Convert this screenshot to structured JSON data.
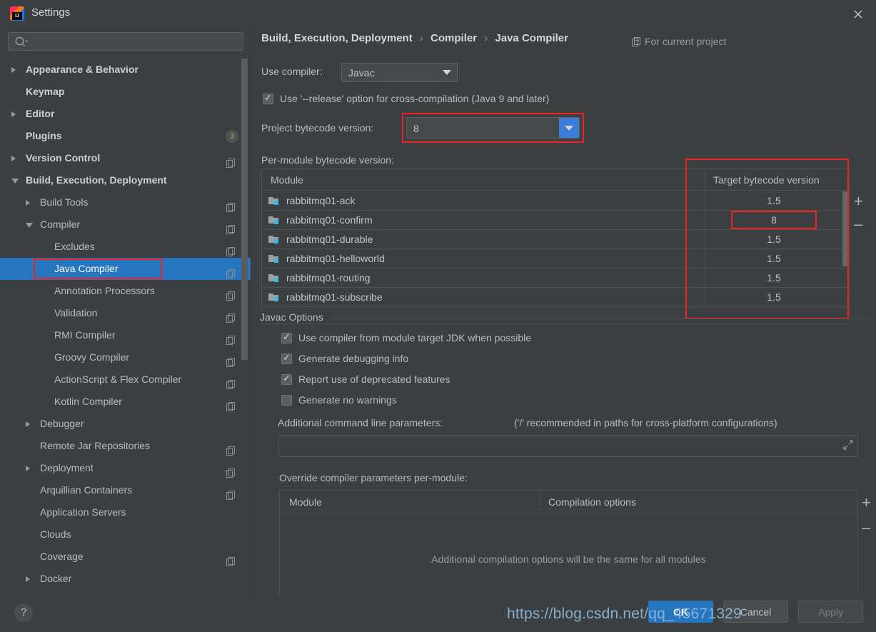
{
  "window": {
    "title": "Settings",
    "app_icon": "intellij-idea-icon",
    "close_icon": "close-icon"
  },
  "search": {
    "placeholder": "",
    "value": "",
    "icon": "search-icon"
  },
  "sidebar": {
    "scrollbar": "vertical-scrollbar",
    "items": [
      {
        "label": "Appearance & Behavior",
        "indent": 36,
        "arrow": "right",
        "bold": true,
        "copy": false,
        "badge": null,
        "selected": false
      },
      {
        "label": "Keymap",
        "indent": 36,
        "arrow": "none",
        "bold": true,
        "copy": false,
        "badge": null,
        "selected": false
      },
      {
        "label": "Editor",
        "indent": 36,
        "arrow": "right",
        "bold": true,
        "copy": false,
        "badge": null,
        "selected": false
      },
      {
        "label": "Plugins",
        "indent": 36,
        "arrow": "none",
        "bold": true,
        "copy": false,
        "badge": "3",
        "selected": false
      },
      {
        "label": "Version Control",
        "indent": 36,
        "arrow": "right",
        "bold": true,
        "copy": true,
        "badge": null,
        "selected": false
      },
      {
        "label": "Build, Execution, Deployment",
        "indent": 36,
        "arrow": "down",
        "bold": true,
        "copy": false,
        "badge": null,
        "selected": false
      },
      {
        "label": "Build Tools",
        "indent": 56,
        "arrow": "right",
        "bold": false,
        "copy": true,
        "badge": null,
        "selected": false
      },
      {
        "label": "Compiler",
        "indent": 56,
        "arrow": "down",
        "bold": false,
        "copy": true,
        "badge": null,
        "selected": false
      },
      {
        "label": "Excludes",
        "indent": 76,
        "arrow": "none",
        "bold": false,
        "copy": true,
        "badge": null,
        "selected": false
      },
      {
        "label": "Java Compiler",
        "indent": 76,
        "arrow": "none",
        "bold": false,
        "copy": true,
        "badge": null,
        "selected": true
      },
      {
        "label": "Annotation Processors",
        "indent": 76,
        "arrow": "none",
        "bold": false,
        "copy": true,
        "badge": null,
        "selected": false
      },
      {
        "label": "Validation",
        "indent": 76,
        "arrow": "none",
        "bold": false,
        "copy": true,
        "badge": null,
        "selected": false
      },
      {
        "label": "RMI Compiler",
        "indent": 76,
        "arrow": "none",
        "bold": false,
        "copy": true,
        "badge": null,
        "selected": false
      },
      {
        "label": "Groovy Compiler",
        "indent": 76,
        "arrow": "none",
        "bold": false,
        "copy": true,
        "badge": null,
        "selected": false
      },
      {
        "label": "ActionScript & Flex Compiler",
        "indent": 76,
        "arrow": "none",
        "bold": false,
        "copy": true,
        "badge": null,
        "selected": false
      },
      {
        "label": "Kotlin Compiler",
        "indent": 76,
        "arrow": "none",
        "bold": false,
        "copy": true,
        "badge": null,
        "selected": false
      },
      {
        "label": "Debugger",
        "indent": 56,
        "arrow": "right",
        "bold": false,
        "copy": false,
        "badge": null,
        "selected": false
      },
      {
        "label": "Remote Jar Repositories",
        "indent": 56,
        "arrow": "none",
        "bold": false,
        "copy": true,
        "badge": null,
        "selected": false
      },
      {
        "label": "Deployment",
        "indent": 56,
        "arrow": "right",
        "bold": false,
        "copy": true,
        "badge": null,
        "selected": false
      },
      {
        "label": "Arquillian Containers",
        "indent": 56,
        "arrow": "none",
        "bold": false,
        "copy": true,
        "badge": null,
        "selected": false
      },
      {
        "label": "Application Servers",
        "indent": 56,
        "arrow": "none",
        "bold": false,
        "copy": false,
        "badge": null,
        "selected": false
      },
      {
        "label": "Clouds",
        "indent": 56,
        "arrow": "none",
        "bold": false,
        "copy": false,
        "badge": null,
        "selected": false
      },
      {
        "label": "Coverage",
        "indent": 56,
        "arrow": "none",
        "bold": false,
        "copy": true,
        "badge": null,
        "selected": false
      },
      {
        "label": "Docker",
        "indent": 56,
        "arrow": "right",
        "bold": false,
        "copy": false,
        "badge": null,
        "selected": false
      }
    ]
  },
  "main": {
    "breadcrumb": {
      "part1": "Build, Execution, Deployment",
      "part2": "Compiler",
      "part3": "Java Compiler",
      "separator": "›"
    },
    "for_current_project": "For current project",
    "for_current_project_icon": "copy-scope-icon",
    "use_compiler": {
      "label": "Use compiler:",
      "value": "Javac",
      "dropdown_icon": "chevron-down-icon"
    },
    "release_option": {
      "label": "Use '--release' option for cross-compilation (Java 9 and later)",
      "checked": true
    },
    "project_bytecode": {
      "label": "Project bytecode version:",
      "value": "8",
      "dropdown_icon": "chevron-down-icon"
    },
    "per_module_label": "Per-module bytecode version:",
    "module_table": {
      "col_module": "Module",
      "col_target": "Target bytecode version",
      "add_icon": "plus-icon",
      "remove_icon": "minus-icon",
      "rows": [
        {
          "module": "rabbitmq01-ack",
          "version": "1.5",
          "highlight": false
        },
        {
          "module": "rabbitmq01-confirm",
          "version": "8",
          "highlight": true
        },
        {
          "module": "rabbitmq01-durable",
          "version": "1.5",
          "highlight": false
        },
        {
          "module": "rabbitmq01-helloworld",
          "version": "1.5",
          "highlight": false
        },
        {
          "module": "rabbitmq01-routing",
          "version": "1.5",
          "highlight": false
        },
        {
          "module": "rabbitmq01-subscribe",
          "version": "1.5",
          "highlight": false
        }
      ]
    },
    "javac_options": {
      "title": "Javac Options",
      "checkboxes": [
        {
          "label": "Use compiler from module target JDK when possible",
          "checked": true
        },
        {
          "label": "Generate debugging info",
          "checked": true
        },
        {
          "label": "Report use of deprecated features",
          "checked": true
        },
        {
          "label": "Generate no warnings",
          "checked": false
        }
      ],
      "additional_params_label": "Additional command line parameters:",
      "additional_params_hint": "('/' recommended in paths for cross-platform configurations)",
      "additional_params_value": "",
      "expand_icon": "expand-icon"
    },
    "override": {
      "label": "Override compiler parameters per-module:",
      "col_module": "Module",
      "col_options": "Compilation options",
      "empty_text": "Additional compilation options will be the same for all modules",
      "add_icon": "plus-icon",
      "remove_icon": "minus-icon"
    }
  },
  "footer": {
    "help_label": "?",
    "ok": "OK",
    "cancel": "Cancel",
    "apply": "Apply"
  },
  "overlay": {
    "watermark": "https://blog.csdn.net/qq_45671329"
  },
  "colors": {
    "accent": "#2675bf",
    "highlight_border": "#ee2222",
    "panel_bg": "#3c3f41",
    "field_bg": "#45494a",
    "text": "#bbbbbb"
  }
}
